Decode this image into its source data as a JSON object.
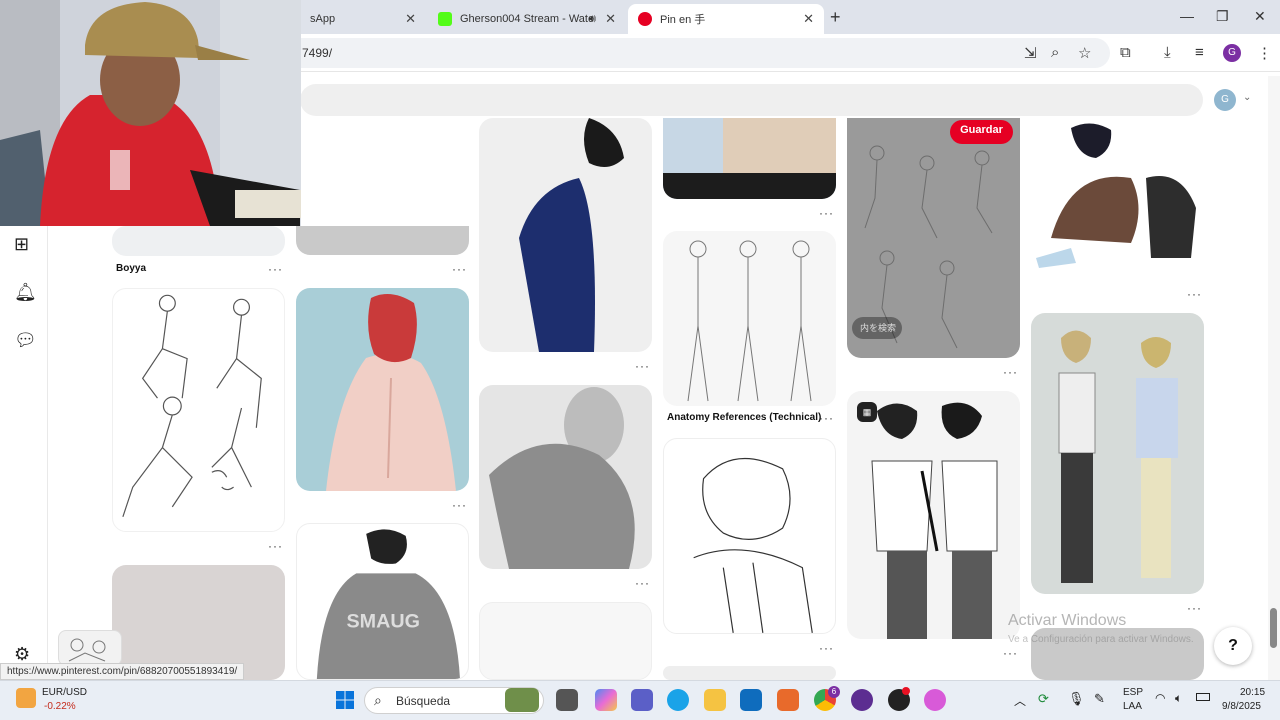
{
  "browser": {
    "tabs": [
      {
        "label": "sApp",
        "color": "#25d366"
      },
      {
        "label": "Gherson004 Stream - Watc",
        "color": "#53fc18"
      },
      {
        "label": "Pin en 手",
        "color": "#e60023"
      }
    ],
    "new_tab": "+",
    "url": "7499/",
    "profile_letter": "G"
  },
  "pinterest": {
    "avatar_letter": "G",
    "save_button": "Guardar",
    "chip_text": "内を検索",
    "pin_labels": {
      "boyya": "Boyya",
      "anatomy": "Anatomy References (Technical)"
    },
    "more": "···",
    "help": "?"
  },
  "status_url": "https://www.pinterest.com/pin/68820700551893419/",
  "watermark": {
    "title": "Activar Windows",
    "subtitle": "Ve a Configuración para activar Windows."
  },
  "taskbar": {
    "ticker_pair": "EUR/USD",
    "ticker_change": "-0.22%",
    "search_placeholder": "Búsqueda",
    "lang": "ESP",
    "region": "LAA",
    "time": "20:15",
    "date": "9/8/2025",
    "badge": "6"
  }
}
